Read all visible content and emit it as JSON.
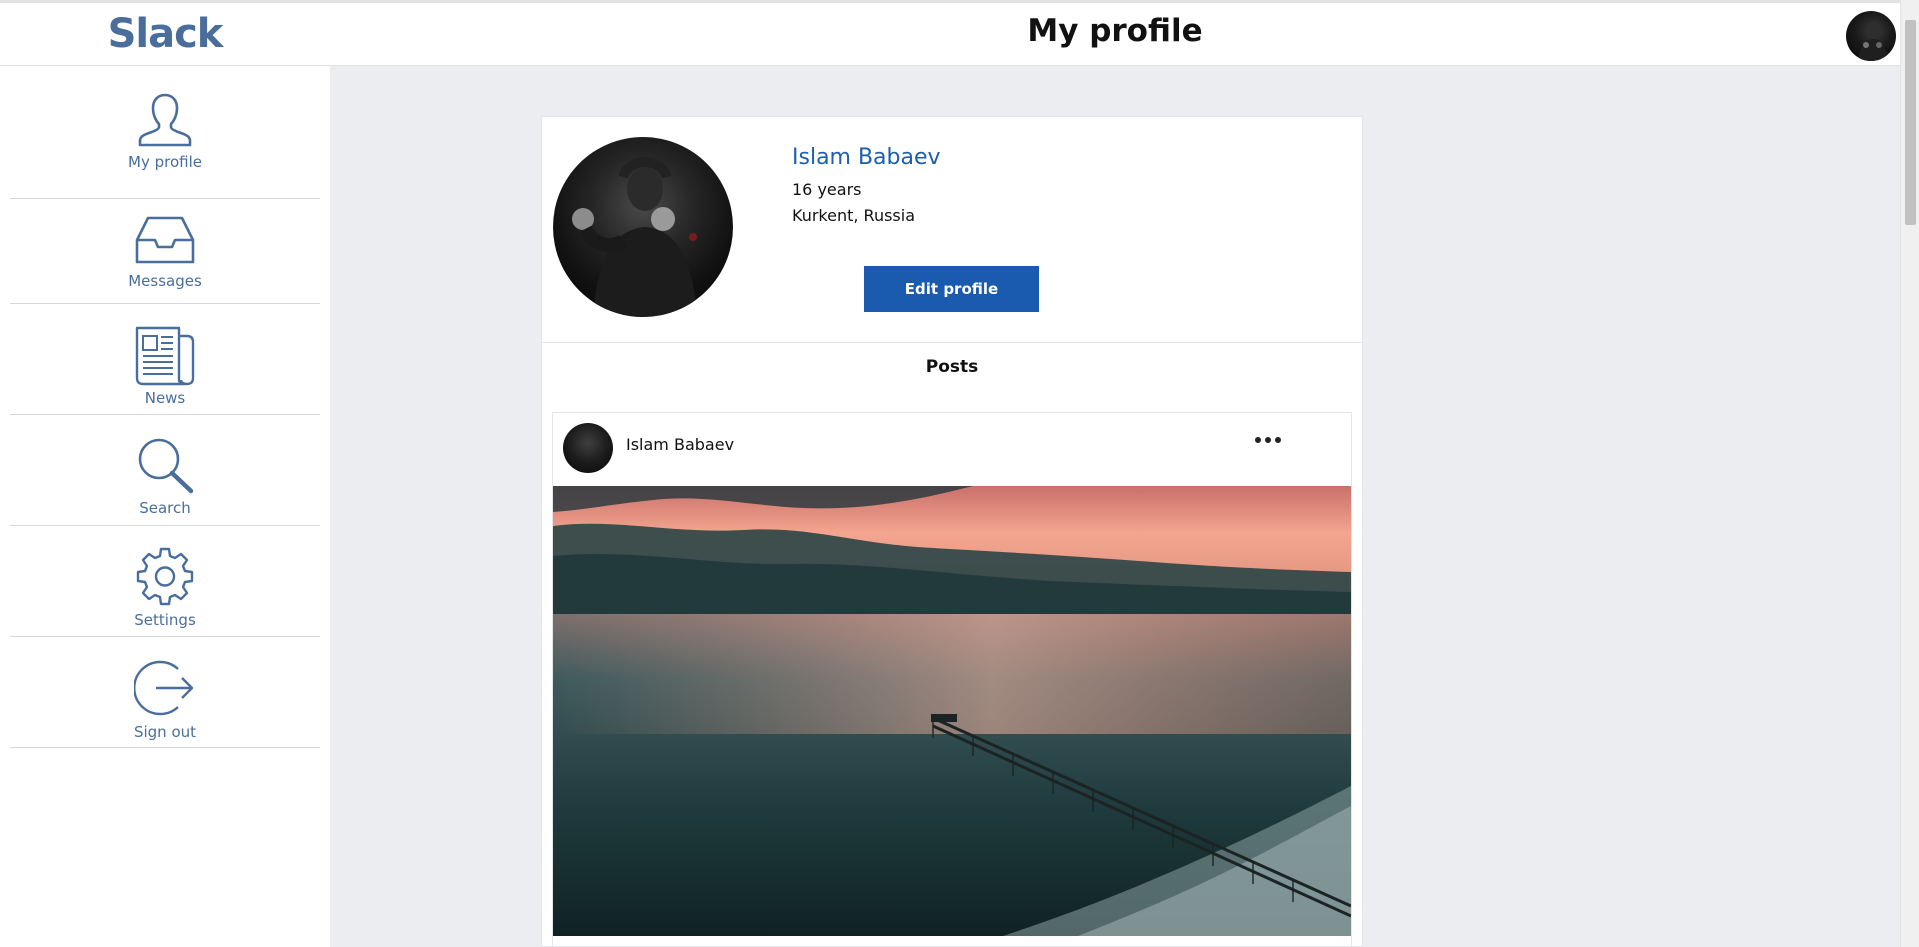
{
  "app": {
    "logo": "Slack",
    "page_title": "My profile"
  },
  "sidebar": {
    "items": [
      {
        "label": "My profile",
        "icon": "user-icon"
      },
      {
        "label": "Messages",
        "icon": "inbox-icon"
      },
      {
        "label": "News",
        "icon": "newspaper-icon"
      },
      {
        "label": "Search",
        "icon": "search-icon"
      },
      {
        "label": "Settings",
        "icon": "gear-icon"
      },
      {
        "label": "Sign out",
        "icon": "sign-out-icon"
      }
    ]
  },
  "profile": {
    "name": "Islam Babaev",
    "age": "16 years",
    "location": "Kurkent, Russia",
    "edit_label": "Edit profile"
  },
  "posts": {
    "heading": "Posts",
    "items": [
      {
        "author": "Islam Babaev",
        "menu_icon": "more-horizontal-icon",
        "image": "sunset-pier-photo"
      }
    ]
  },
  "colors": {
    "accent": "#1a5baf",
    "brand": "#4a6e9c",
    "background": "#ebedf0"
  }
}
